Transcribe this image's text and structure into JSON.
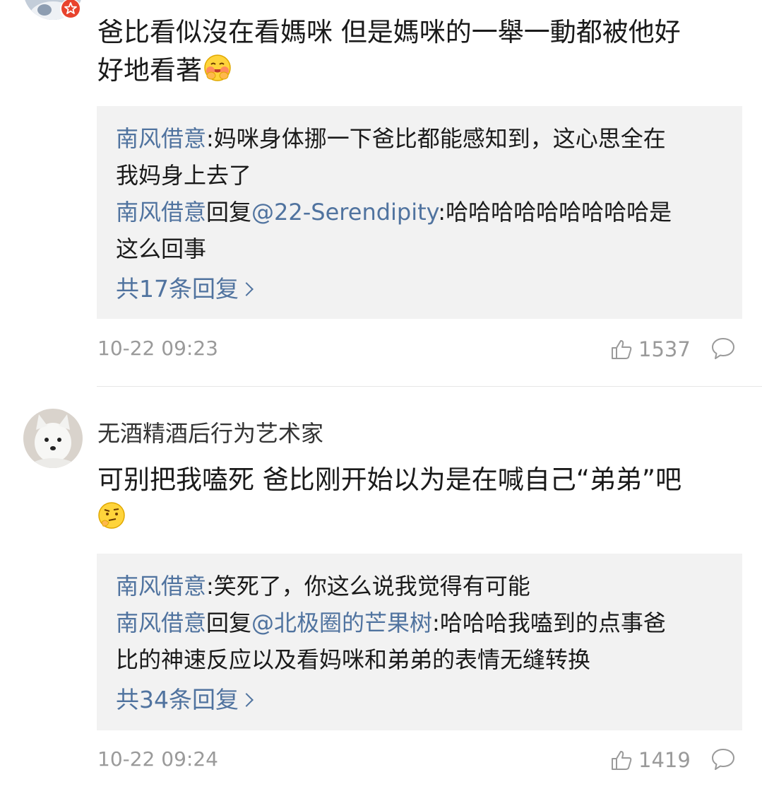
{
  "comments": [
    {
      "text": "爸比看似沒在看媽咪 但是媽咪的一舉一動都被他好好地看著",
      "text_line1": "爸比看似沒在看媽咪 但是媽咪的一舉一動都被他好",
      "text_line2": "好地看著",
      "emoji": "hugging-face-emoji",
      "replies": [
        {
          "author": "南风借意",
          "sep": ":",
          "text_line1": "妈咪身体挪一下爸比都能感知到，这心思全在",
          "text_line2": "我妈身上去了"
        },
        {
          "author": "南风借意",
          "reply_word": "回复",
          "mention": "@22-Serendipity",
          "sep": ":",
          "text_line1": "哈哈哈哈哈哈哈哈哈是",
          "text_line2": "这么回事"
        }
      ],
      "more_replies": "共17条回复",
      "timestamp": "10-22 09:23",
      "likes": "1537"
    },
    {
      "username": "无酒精酒后行为艺术家",
      "text_line1": "可别把我嗑死 爸比刚开始以为是在喊自己“弟弟”吧",
      "emoji": "thinking-face-emoji",
      "replies": [
        {
          "author": "南风借意",
          "sep": ":",
          "text_line1": "笑死了，你这么说我觉得有可能"
        },
        {
          "author": "南风借意",
          "reply_word": "回复",
          "mention": "@北极圈的芒果树",
          "sep": ":",
          "text_line1": "哈哈哈我嗑到的点事爸",
          "text_line2": "比的神速反应以及看妈咪和弟弟的表情无缝转换"
        }
      ],
      "more_replies": "共34条回复",
      "timestamp": "10-22 09:24",
      "likes": "1419"
    }
  ],
  "colors": {
    "link": "#50739f",
    "reply_bg": "#f2f2f2",
    "meta": "#9a9a9a",
    "badge": "#e8432e"
  }
}
